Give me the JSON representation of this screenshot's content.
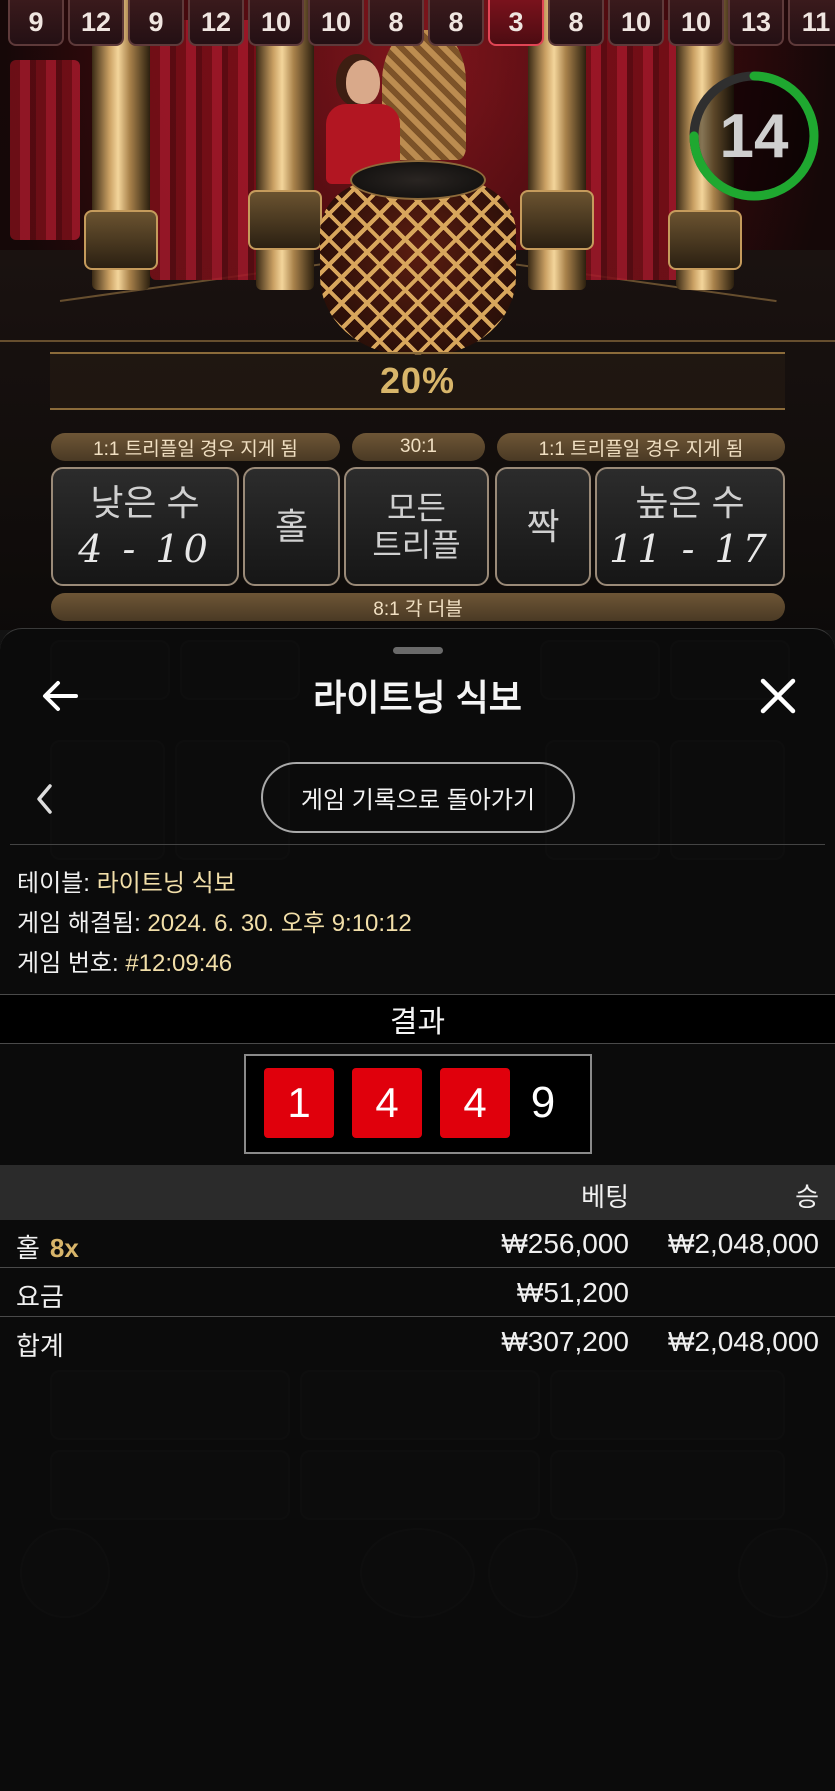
{
  "history": [
    "9",
    "12",
    "9",
    "12",
    "10",
    "10",
    "8",
    "8",
    "3",
    "8",
    "10",
    "10",
    "13",
    "11"
  ],
  "history_highlight_index": 8,
  "timer": {
    "value": "14",
    "progress": 0.75,
    "color": "#1fa830"
  },
  "multiplier": "20%",
  "board": {
    "pay_left": "1:1 트리플일 경우 지게 됨",
    "pay_center": "30:1",
    "pay_right": "1:1 트리플일 경우 지게 됨",
    "pay_bottom": "8:1 각 더블",
    "low_label": "낮은 수",
    "low_range": "4 - 10",
    "odd_label": "홀",
    "any_triple_line1": "모든",
    "any_triple_line2": "트리플",
    "even_label": "짝",
    "high_label": "높은 수",
    "high_range": "11 - 17"
  },
  "panel": {
    "title": "라이트닝 식보",
    "back_to_history": "게임 기록으로 돌아가기",
    "table_label": "테이블:",
    "table_value": "라이트닝 식보",
    "resolved_label": "게임 해결됨:",
    "resolved_value": "2024. 6. 30. 오후 9:10:12",
    "game_no_label": "게임 번호:",
    "game_no_value": "#12:09:46",
    "result_header": "결과",
    "dice": [
      "1",
      "4",
      "4"
    ],
    "dice_total": "9",
    "col_bet": "베팅",
    "col_win": "승",
    "rows": [
      {
        "name": "홀",
        "mult": "8x",
        "bet": "₩256,000",
        "win": "₩2,048,000"
      },
      {
        "name": "요금",
        "mult": "",
        "bet": "₩51,200",
        "win": ""
      },
      {
        "name": "합계",
        "mult": "",
        "bet": "₩307,200",
        "win": "₩2,048,000"
      }
    ]
  },
  "colors": {
    "gold": "#d8b56a",
    "die_red": "#e0000c",
    "value_yellow": "#f2dfa9"
  }
}
